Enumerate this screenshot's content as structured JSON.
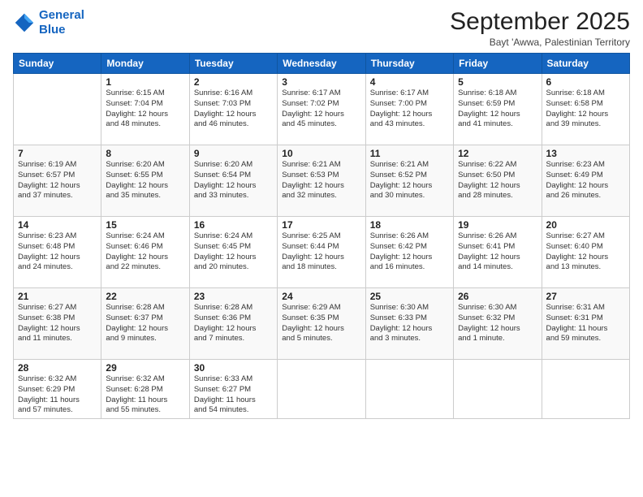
{
  "header": {
    "logo_line1": "General",
    "logo_line2": "Blue",
    "month": "September 2025",
    "location": "Bayt 'Awwa, Palestinian Territory"
  },
  "weekdays": [
    "Sunday",
    "Monday",
    "Tuesday",
    "Wednesday",
    "Thursday",
    "Friday",
    "Saturday"
  ],
  "weeks": [
    [
      {
        "day": "",
        "info": ""
      },
      {
        "day": "1",
        "info": "Sunrise: 6:15 AM\nSunset: 7:04 PM\nDaylight: 12 hours\nand 48 minutes."
      },
      {
        "day": "2",
        "info": "Sunrise: 6:16 AM\nSunset: 7:03 PM\nDaylight: 12 hours\nand 46 minutes."
      },
      {
        "day": "3",
        "info": "Sunrise: 6:17 AM\nSunset: 7:02 PM\nDaylight: 12 hours\nand 45 minutes."
      },
      {
        "day": "4",
        "info": "Sunrise: 6:17 AM\nSunset: 7:00 PM\nDaylight: 12 hours\nand 43 minutes."
      },
      {
        "day": "5",
        "info": "Sunrise: 6:18 AM\nSunset: 6:59 PM\nDaylight: 12 hours\nand 41 minutes."
      },
      {
        "day": "6",
        "info": "Sunrise: 6:18 AM\nSunset: 6:58 PM\nDaylight: 12 hours\nand 39 minutes."
      }
    ],
    [
      {
        "day": "7",
        "info": "Sunrise: 6:19 AM\nSunset: 6:57 PM\nDaylight: 12 hours\nand 37 minutes."
      },
      {
        "day": "8",
        "info": "Sunrise: 6:20 AM\nSunset: 6:55 PM\nDaylight: 12 hours\nand 35 minutes."
      },
      {
        "day": "9",
        "info": "Sunrise: 6:20 AM\nSunset: 6:54 PM\nDaylight: 12 hours\nand 33 minutes."
      },
      {
        "day": "10",
        "info": "Sunrise: 6:21 AM\nSunset: 6:53 PM\nDaylight: 12 hours\nand 32 minutes."
      },
      {
        "day": "11",
        "info": "Sunrise: 6:21 AM\nSunset: 6:52 PM\nDaylight: 12 hours\nand 30 minutes."
      },
      {
        "day": "12",
        "info": "Sunrise: 6:22 AM\nSunset: 6:50 PM\nDaylight: 12 hours\nand 28 minutes."
      },
      {
        "day": "13",
        "info": "Sunrise: 6:23 AM\nSunset: 6:49 PM\nDaylight: 12 hours\nand 26 minutes."
      }
    ],
    [
      {
        "day": "14",
        "info": "Sunrise: 6:23 AM\nSunset: 6:48 PM\nDaylight: 12 hours\nand 24 minutes."
      },
      {
        "day": "15",
        "info": "Sunrise: 6:24 AM\nSunset: 6:46 PM\nDaylight: 12 hours\nand 22 minutes."
      },
      {
        "day": "16",
        "info": "Sunrise: 6:24 AM\nSunset: 6:45 PM\nDaylight: 12 hours\nand 20 minutes."
      },
      {
        "day": "17",
        "info": "Sunrise: 6:25 AM\nSunset: 6:44 PM\nDaylight: 12 hours\nand 18 minutes."
      },
      {
        "day": "18",
        "info": "Sunrise: 6:26 AM\nSunset: 6:42 PM\nDaylight: 12 hours\nand 16 minutes."
      },
      {
        "day": "19",
        "info": "Sunrise: 6:26 AM\nSunset: 6:41 PM\nDaylight: 12 hours\nand 14 minutes."
      },
      {
        "day": "20",
        "info": "Sunrise: 6:27 AM\nSunset: 6:40 PM\nDaylight: 12 hours\nand 13 minutes."
      }
    ],
    [
      {
        "day": "21",
        "info": "Sunrise: 6:27 AM\nSunset: 6:38 PM\nDaylight: 12 hours\nand 11 minutes."
      },
      {
        "day": "22",
        "info": "Sunrise: 6:28 AM\nSunset: 6:37 PM\nDaylight: 12 hours\nand 9 minutes."
      },
      {
        "day": "23",
        "info": "Sunrise: 6:28 AM\nSunset: 6:36 PM\nDaylight: 12 hours\nand 7 minutes."
      },
      {
        "day": "24",
        "info": "Sunrise: 6:29 AM\nSunset: 6:35 PM\nDaylight: 12 hours\nand 5 minutes."
      },
      {
        "day": "25",
        "info": "Sunrise: 6:30 AM\nSunset: 6:33 PM\nDaylight: 12 hours\nand 3 minutes."
      },
      {
        "day": "26",
        "info": "Sunrise: 6:30 AM\nSunset: 6:32 PM\nDaylight: 12 hours\nand 1 minute."
      },
      {
        "day": "27",
        "info": "Sunrise: 6:31 AM\nSunset: 6:31 PM\nDaylight: 11 hours\nand 59 minutes."
      }
    ],
    [
      {
        "day": "28",
        "info": "Sunrise: 6:32 AM\nSunset: 6:29 PM\nDaylight: 11 hours\nand 57 minutes."
      },
      {
        "day": "29",
        "info": "Sunrise: 6:32 AM\nSunset: 6:28 PM\nDaylight: 11 hours\nand 55 minutes."
      },
      {
        "day": "30",
        "info": "Sunrise: 6:33 AM\nSunset: 6:27 PM\nDaylight: 11 hours\nand 54 minutes."
      },
      {
        "day": "",
        "info": ""
      },
      {
        "day": "",
        "info": ""
      },
      {
        "day": "",
        "info": ""
      },
      {
        "day": "",
        "info": ""
      }
    ]
  ]
}
